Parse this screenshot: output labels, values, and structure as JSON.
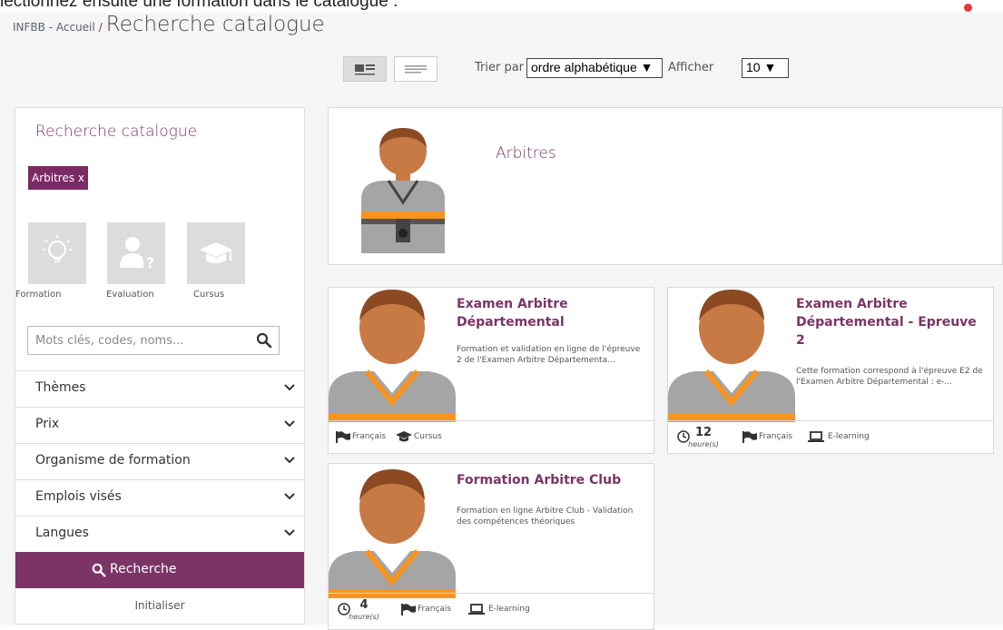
{
  "caption": "lectionnez ensuite une formation dans le catalogue :",
  "breadcrumb": {
    "home": "INFBB - Accueil",
    "separator": "/",
    "current": "Recherche catalogue"
  },
  "toolbar": {
    "sort_label": "Trier par",
    "sort_value": "ordre alphabétique ▼",
    "show_label": "Afficher",
    "show_value": "10 ▼"
  },
  "sidebar": {
    "title": "Recherche catalogue",
    "active_tag": "Arbitres x",
    "types": [
      {
        "label": "Formation",
        "icon": "lightbulb-icon"
      },
      {
        "label": "Evaluation",
        "icon": "user-question-icon"
      },
      {
        "label": "Cursus",
        "icon": "graduation-cap-icon"
      }
    ],
    "search_placeholder": "Mots clés, codes, noms...",
    "filters": [
      "Thèmes",
      "Prix",
      "Organisme de formation",
      "Emplois visés",
      "Langues"
    ],
    "search_button": "Recherche",
    "reset": "Initialiser"
  },
  "category": {
    "title": "Arbitres",
    "icon": "referee-avatar-icon"
  },
  "courses": [
    {
      "title": "Examen Arbitre Départemental",
      "description": "Formation et validation en ligne de l'épreuve 2 de l'Examen Arbitre Départementa...",
      "language": "Français",
      "format": "Cursus",
      "format_icon": "graduation-cap-icon"
    },
    {
      "title": "Examen Arbitre Départemental - Epreuve 2",
      "description": "Cette formation correspond à l'épreuve E2 de l'Examen Arbitre Départemental : e-...",
      "duration": "12",
      "duration_unit": "heure(s)",
      "language": "Français",
      "format": "E-learning",
      "format_icon": "laptop-icon"
    },
    {
      "title": "Formation Arbitre Club",
      "description": "Formation en ligne Arbitre Club - Validation des compétences théoriques",
      "duration": "4",
      "duration_unit": "heure(s)",
      "language": "Français",
      "format": "E-learning",
      "format_icon": "laptop-icon"
    }
  ],
  "colors": {
    "accent": "#7b3466",
    "tag": "#7b2a64",
    "page_bg": "#f5f5f5",
    "orange": "#f7931e",
    "skin": "#c87a44"
  }
}
